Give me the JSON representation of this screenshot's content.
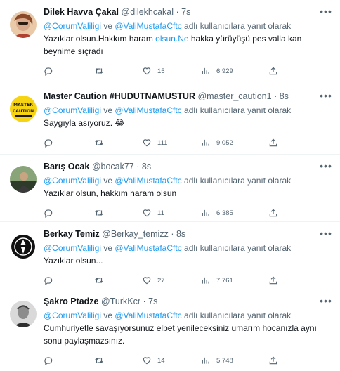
{
  "reply_prefix_label": "adlı kullanıcılara yanıt olarak",
  "conjunction": "ve",
  "tweets": [
    {
      "name": "Dilek Havva Çakal",
      "handle": "@dilekhcakal",
      "time": "7s",
      "mention1": "@CorumValiligi",
      "mention2": "@ValiMustafaCftc",
      "text_a": "Yazıklar olsun.Hakkım haram ",
      "text_link": "olsun.Ne",
      "text_b": " hakka yürüyüşü pes valla kan beynime sıçradı",
      "replies": "",
      "retweets": "",
      "likes": "15",
      "views": "6.929",
      "avatar_colors": [
        "#e9c9a8",
        "#8a4a2a"
      ]
    },
    {
      "name": "Master Caution #HUDUTNAMUSTUR",
      "handle": "@master_caution1",
      "time": "8s",
      "mention1": "@CorumValiligi",
      "mention2": "@ValiMustafaCftc",
      "text": "Saygıyla asıyoruz. 😂",
      "replies": "",
      "retweets": "",
      "likes": "111",
      "views": "9.052",
      "avatar_text": "MASTER CAUTION",
      "avatar_colors": [
        "#f6d313",
        "#1a1a1a"
      ]
    },
    {
      "name": "Barış Ocak",
      "handle": "@bocak77",
      "time": "8s",
      "mention1": "@CorumValiligi",
      "mention2": "@ValiMustafaCftc",
      "text": "Yazıklar olsun, hakkım haram olsun",
      "replies": "",
      "retweets": "",
      "likes": "11",
      "views": "6.385",
      "avatar_colors": [
        "#5e7a52",
        "#2e3b2a"
      ]
    },
    {
      "name": "Berkay Temiz",
      "handle": "@Berkay_temizz",
      "time": "8s",
      "mention1": "@CorumValiligi",
      "mention2": "@ValiMustafaCftc",
      "text": "Yazıklar olsun...",
      "replies": "",
      "retweets": "",
      "likes": "27",
      "views": "7.761",
      "avatar_colors": [
        "#111111",
        "#ffffff"
      ]
    },
    {
      "name": "Şakro Ptadze",
      "handle": "@TurkKcr",
      "time": "7s",
      "mention1": "@CorumValiligi",
      "mention2": "@ValiMustafaCftc",
      "text": "Cumhuriyetle savaşıyorsunuz elbet yenileceksiniz  umarım hocanızla aynı sonu paylaşmazsınız.",
      "replies": "",
      "retweets": "",
      "likes": "14",
      "views": "5.748",
      "avatar_colors": [
        "#cfcfcf",
        "#3a3a3a"
      ]
    }
  ],
  "icons": {
    "reply": "reply-icon",
    "retweet": "retweet-icon",
    "like": "like-icon",
    "views": "views-icon",
    "share": "share-icon",
    "more": "more-icon"
  },
  "colors": {
    "link": "#1d9bf0",
    "secondary": "#536471",
    "primary": "#0f1419",
    "divider": "#eff3f4"
  }
}
